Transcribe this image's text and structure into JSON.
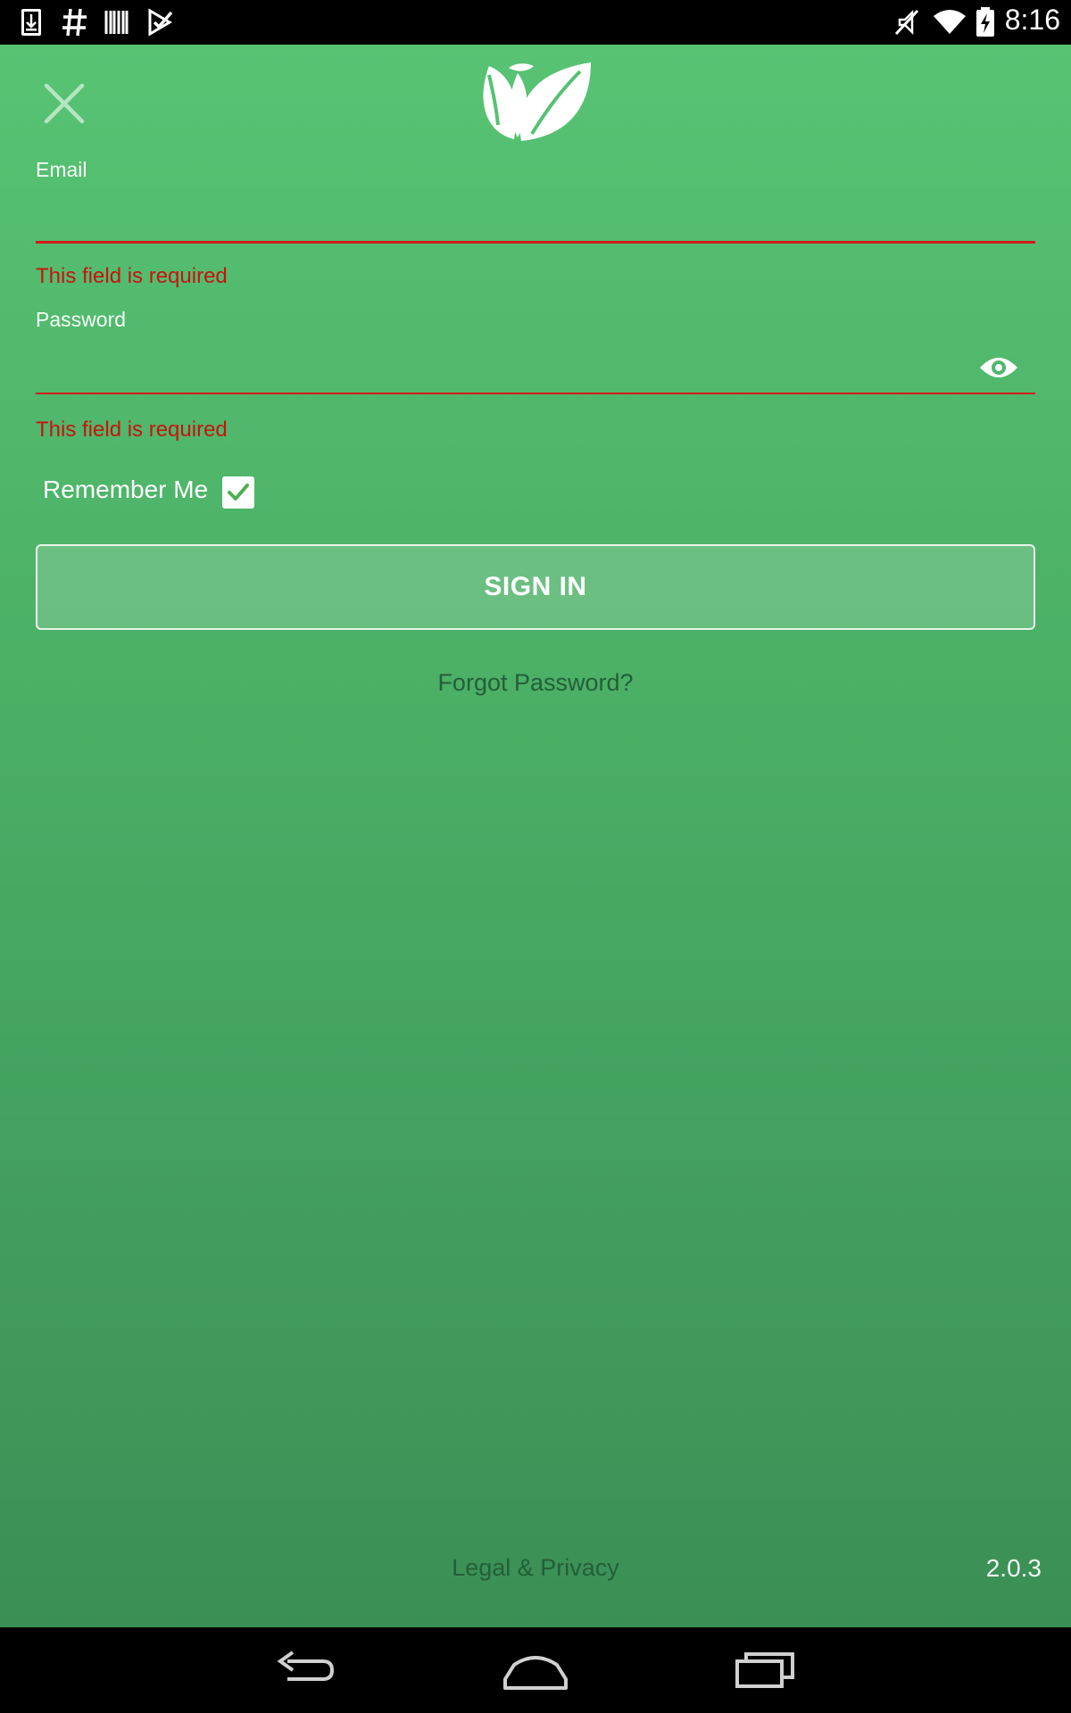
{
  "status_bar": {
    "time": "8:16",
    "left_icons": [
      "download-icon",
      "hash-icon",
      "barcode-icon",
      "task-check-icon"
    ],
    "right_icons": [
      "vibrate-off-icon",
      "wifi-icon",
      "battery-charging-icon"
    ]
  },
  "header": {
    "close_icon": "close-icon",
    "logo_icon": "leaf-logo-icon"
  },
  "form": {
    "email": {
      "label": "Email",
      "value": "",
      "error": "This field is required"
    },
    "password": {
      "label": "Password",
      "value": "",
      "error": "This field is required",
      "toggle_icon": "eye-icon"
    },
    "remember_me": {
      "label": "Remember Me",
      "checked": true
    },
    "sign_in_label": "SIGN IN",
    "forgot_password_label": "Forgot Password?"
  },
  "footer": {
    "legal_label": "Legal & Privacy",
    "version": "2.0.3"
  },
  "nav_bar": {
    "icons": [
      "back-icon",
      "home-icon",
      "recent-apps-icon"
    ]
  },
  "colors": {
    "background_top": "#57c373",
    "background_bottom": "#3b8f55",
    "error": "#c9120f",
    "link": "#235f37",
    "checkbox_check": "#4caf50"
  }
}
